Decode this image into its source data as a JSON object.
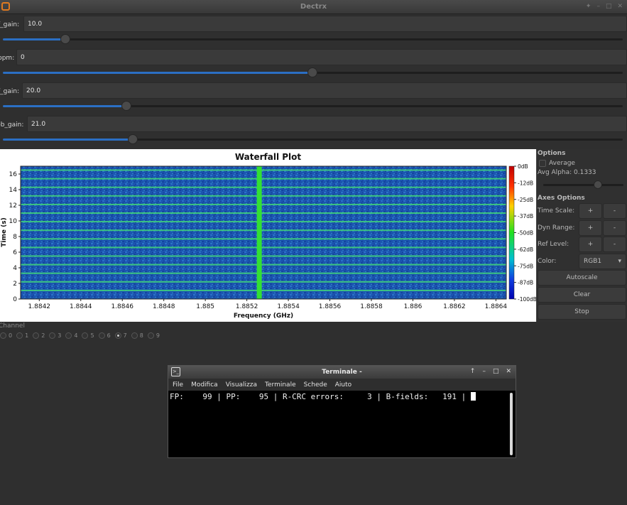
{
  "window": {
    "title": "Dectrx"
  },
  "params": [
    {
      "label": "f_gain:",
      "value": "10.0",
      "level": 0.1
    },
    {
      "label": "ppm:",
      "value": "0",
      "level": 0.5
    },
    {
      "label": "f_gain:",
      "value": "20.0",
      "level": 0.2
    },
    {
      "label": "bb_gain:",
      "value": "21.0",
      "level": 0.21
    }
  ],
  "chart_data": {
    "type": "heatmap",
    "title": "Waterfall Plot",
    "xlabel": "Frequency (GHz)",
    "ylabel": "Time (s)",
    "xlim": [
      1.88411,
      1.88645
    ],
    "ylim": [
      0,
      17
    ],
    "x_ticks": [
      "1.8842",
      "1.8844",
      "1.8846",
      "1.8848",
      "1.885",
      "1.8852",
      "1.8854",
      "1.8856",
      "1.8858",
      "1.886",
      "1.8862",
      "1.8864"
    ],
    "y_ticks": [
      "0",
      "2",
      "4",
      "6",
      "8",
      "10",
      "12",
      "14",
      "16"
    ],
    "colorbar_ticks": [
      "0dB",
      "-12dB",
      "-25dB",
      "-37dB",
      "-50dB",
      "-62dB",
      "-75dB",
      "-87dB",
      "-100dB"
    ],
    "carrier_frequency": 1.88526,
    "burst_times": [
      1.1,
      2.2,
      3.3,
      4.4,
      5.5,
      6.6,
      7.7,
      8.8,
      9.9,
      11.0,
      12.1,
      13.2,
      14.3,
      15.4,
      16.5
    ]
  },
  "options": {
    "header": "Options",
    "average_label": "Average",
    "avg_alpha_label": "Avg Alpha: 0.1333",
    "axes_header": "Axes Options",
    "time_scale_label": "Time Scale:",
    "dyn_range_label": "Dyn Range:",
    "ref_level_label": "Ref Level:",
    "color_label": "Color:",
    "color_value": "RGB1",
    "plus": "+",
    "minus": "-",
    "autoscale": "Autoscale",
    "clear": "Clear",
    "stop": "Stop"
  },
  "channel": {
    "label": "Channel",
    "options": [
      "0",
      "1",
      "2",
      "3",
      "4",
      "5",
      "6",
      "7",
      "8",
      "9"
    ],
    "selected": "7"
  },
  "terminal": {
    "title": "Terminale -",
    "menu": [
      "File",
      "Modifica",
      "Visualizza",
      "Terminale",
      "Schede",
      "Aiuto"
    ],
    "line": "FP:    99 | PP:    95 | R-CRC errors:     3 | B-fields:   191 | "
  }
}
